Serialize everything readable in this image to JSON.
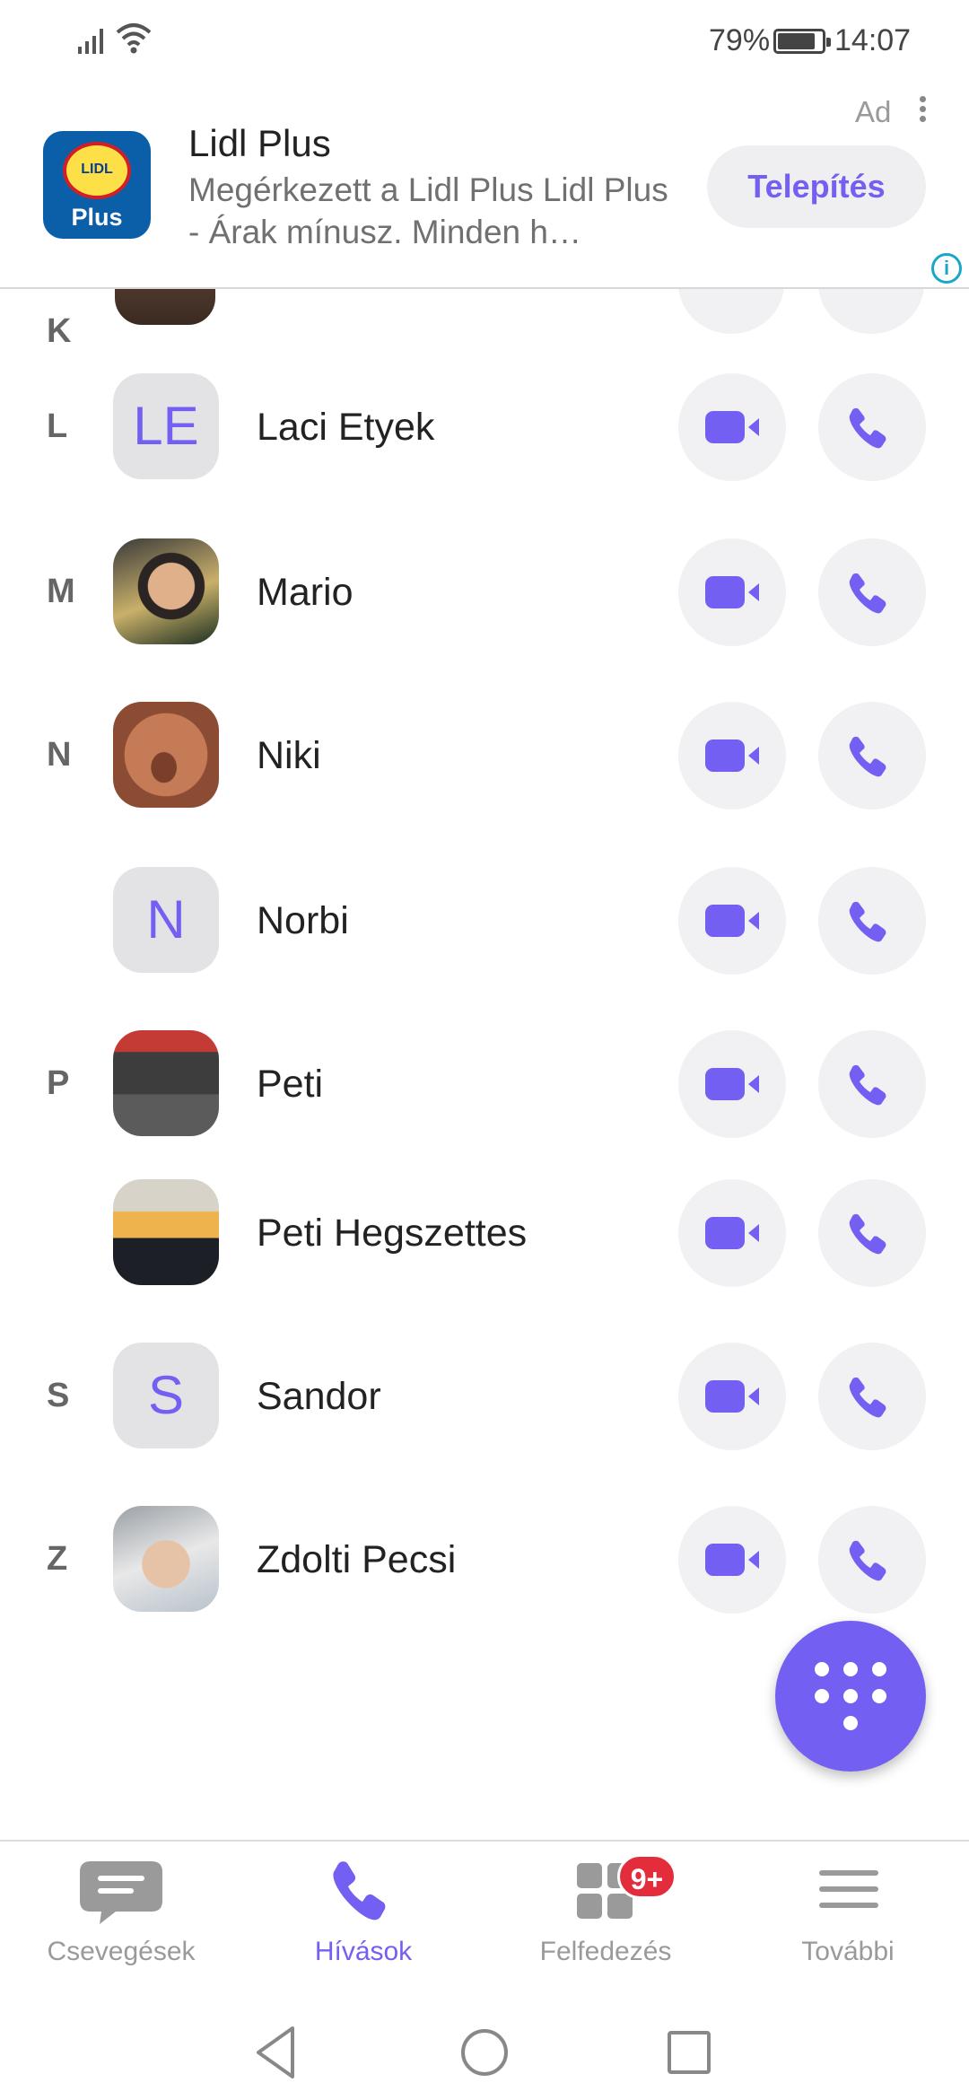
{
  "status_bar": {
    "battery_percent": "79%",
    "battery_level": 0.79,
    "time": "14:07"
  },
  "ad": {
    "label": "Ad",
    "app_name": "Lidl Plus",
    "description": "Megérkezett a Lidl Plus Lidl Plus - Árak mínusz. Minden h…",
    "install_label": "Telepítés",
    "logo_text": "LIDL",
    "logo_sub": "Plus",
    "info_icon": "i"
  },
  "contacts": {
    "section_k": "K",
    "rows": [
      {
        "letter": "L",
        "initials": "LE",
        "name": "Laci Etyek"
      },
      {
        "letter": "M",
        "initials": "",
        "name": "Mario"
      },
      {
        "letter": "N",
        "initials": "",
        "name": "Niki"
      },
      {
        "letter": "",
        "initials": "N",
        "name": "Norbi"
      },
      {
        "letter": "P",
        "initials": "",
        "name": "Peti"
      },
      {
        "letter": "",
        "initials": "",
        "name": "Peti Hegszettes"
      },
      {
        "letter": "S",
        "initials": "S",
        "name": "Sandor"
      },
      {
        "letter": "Z",
        "initials": "",
        "name": "Zdolti Pecsi"
      }
    ]
  },
  "bottom_nav": {
    "chats": "Csevegések",
    "calls": "Hívások",
    "explore": "Felfedezés",
    "explore_badge": "9+",
    "more": "További"
  },
  "colors": {
    "accent": "#7360f2",
    "badge": "#e32c3c",
    "button_bg": "#f1f1f3"
  },
  "icons": {
    "video": "video-call-icon",
    "call": "phone-icon",
    "dialpad": "dialpad-icon"
  }
}
